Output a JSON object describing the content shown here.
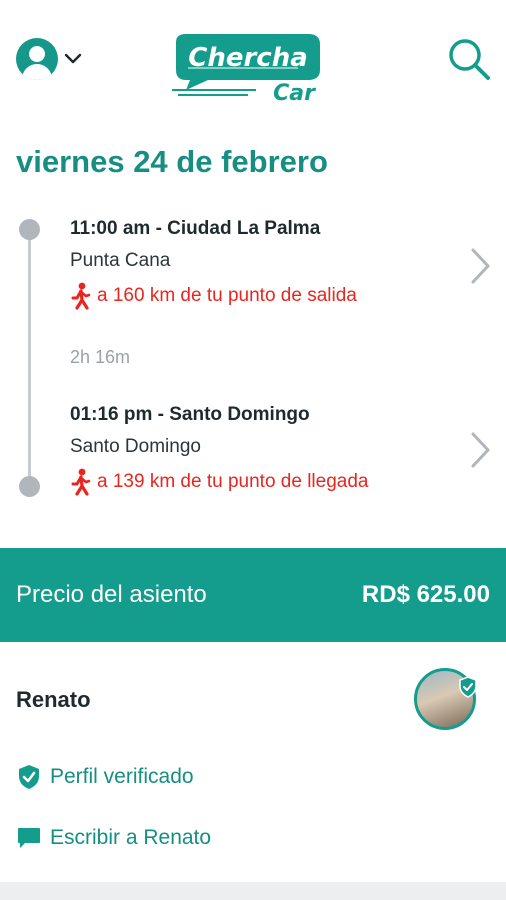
{
  "header": {
    "avatar_icon": "user-avatar-icon",
    "menu_icon": "chevron-down-icon",
    "logo": {
      "line1": "Chercha",
      "line2": "Car",
      "color": "#149c8d"
    },
    "search_icon": "search-icon"
  },
  "trip": {
    "date": "viernes 24 de febrero",
    "departure": {
      "time_place": "11:00 am - Ciudad La Palma",
      "city": "Punta Cana",
      "distance": "a 160 km de tu punto de salida"
    },
    "duration": "2h 16m",
    "arrival": {
      "time_place": "01:16 pm - Santo Domingo",
      "city": "Santo Domingo",
      "distance": "a 139 km de tu punto de llegada"
    }
  },
  "price": {
    "label": "Precio del asiento",
    "value": "RD$ 625.00"
  },
  "driver": {
    "name": "Renato",
    "verified_label": "Perfil verificado",
    "message_label": "Escribir a Renato"
  },
  "colors": {
    "accent": "#149c8d",
    "warning": "#e8261f",
    "text_dark": "#1f2a2e",
    "muted": "#9aa2a7"
  }
}
